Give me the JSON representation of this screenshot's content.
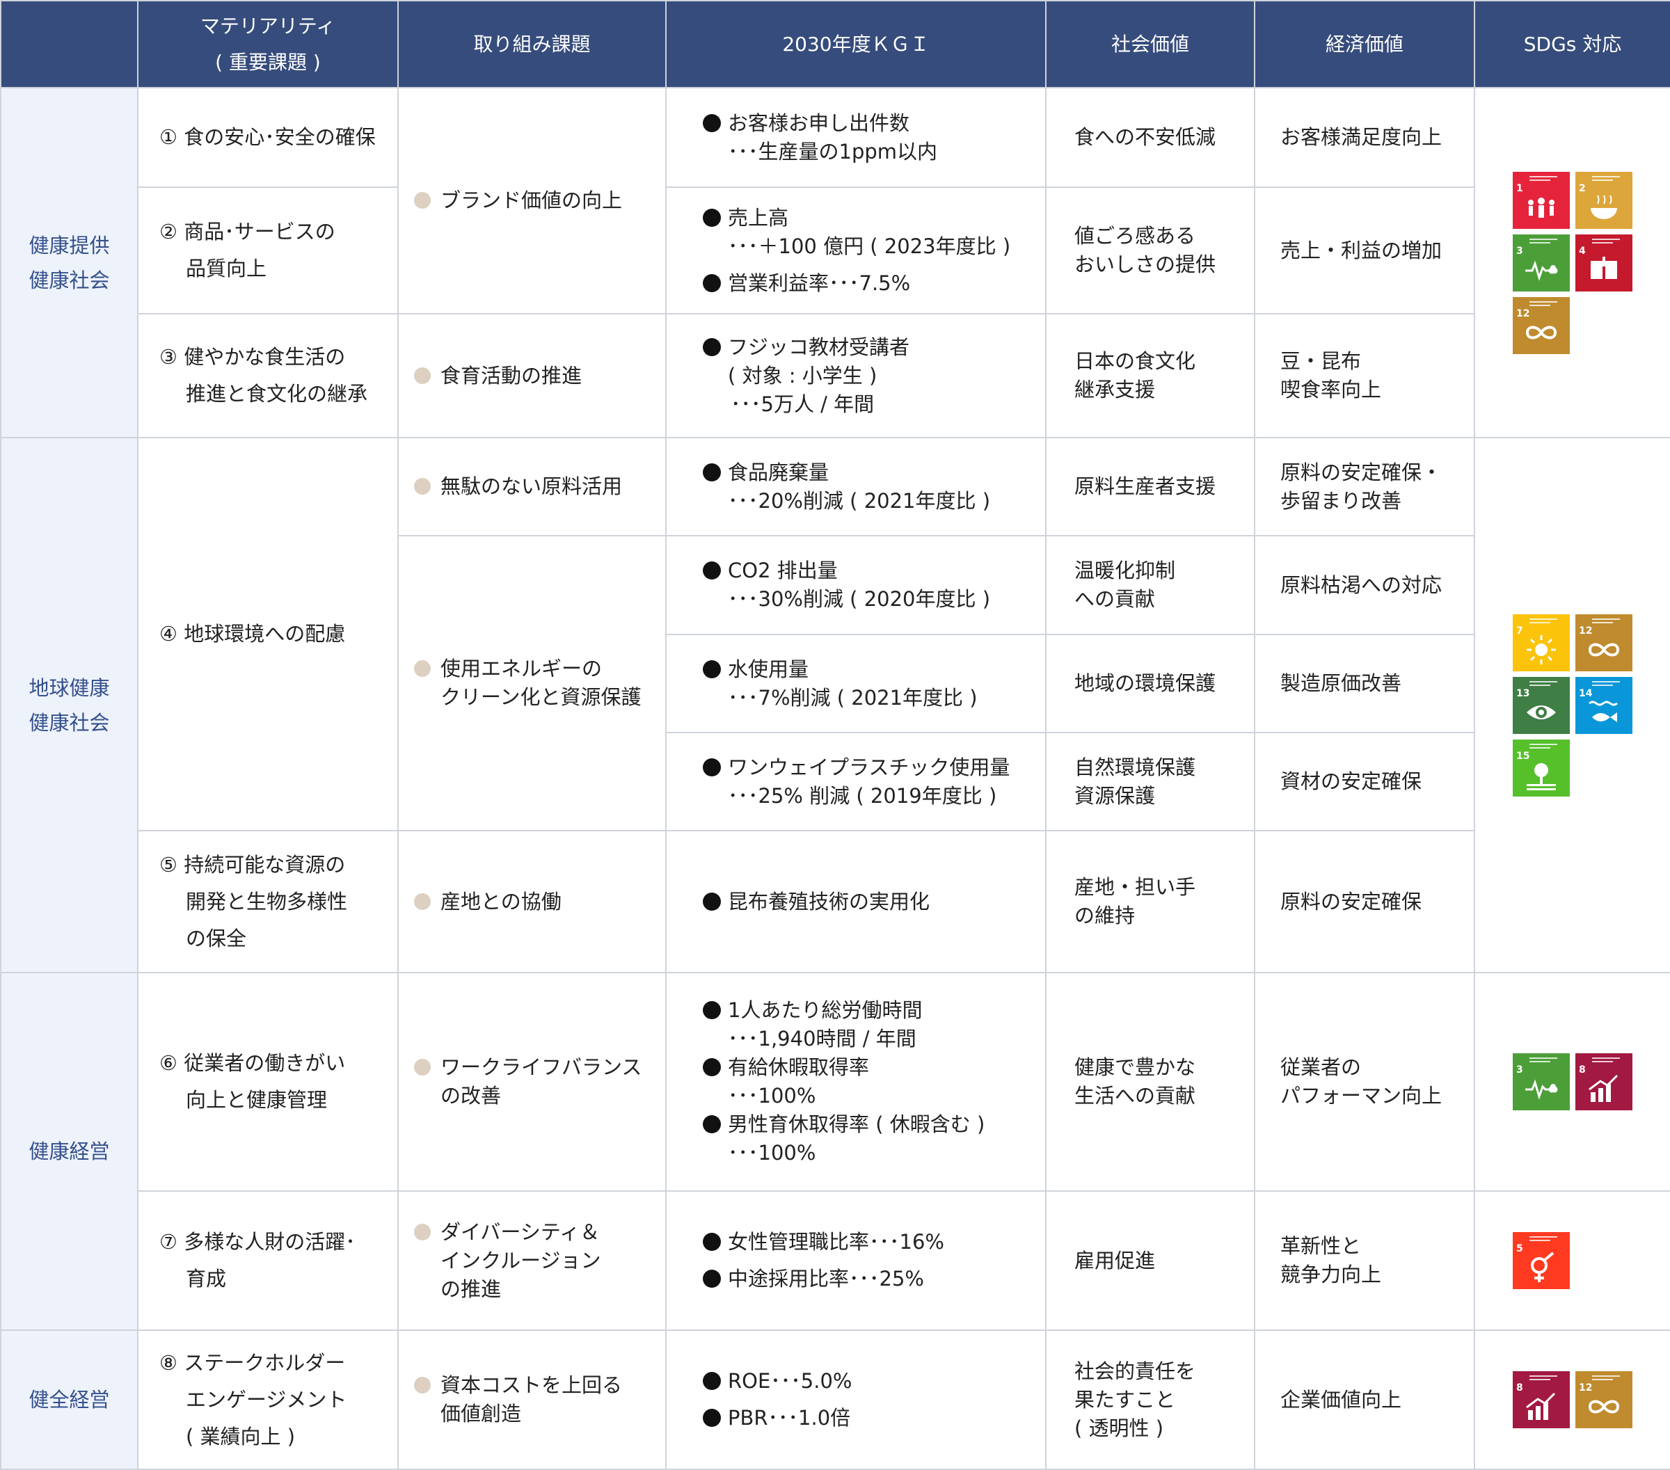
{
  "header": {
    "col1": "",
    "col2_line1": "マテリアリティ",
    "col2_line2": "( 重要課題 )",
    "col3": "取り組み課題",
    "col4": "2030年度ＫＧＩ",
    "col5": "社会価値",
    "col6": "経済価値",
    "col7": "SDGs 対応"
  },
  "categories": {
    "c1_line1": "健康提供",
    "c1_line2": "健康社会",
    "c2_line1": "地球健康",
    "c2_line2": "健康社会",
    "c3": "健康経営",
    "c4": "健全経営"
  },
  "materiality": {
    "m1_num": "①",
    "m1": "食の安心･安全の確保",
    "m2_num": "②",
    "m2_l1": "商品･サービスの",
    "m2_l2": "品質向上",
    "m3_num": "③",
    "m3_l1": "健やかな食生活の",
    "m3_l2": "推進と食文化の継承",
    "m4_num": "④",
    "m4": "地球環境への配慮",
    "m5_num": "⑤",
    "m5_l1": "持続可能な資源の",
    "m5_l2": "開発と生物多様性",
    "m5_l3": "の保全",
    "m6_num": "⑥",
    "m6_l1": "従業者の働きがい",
    "m6_l2": "向上と健康管理",
    "m7_num": "⑦",
    "m7_l1": "多様な人財の活躍･",
    "m7_l2": "育成",
    "m8_num": "⑧",
    "m8_l1": "ステークホルダー",
    "m8_l2": "エンゲージメント",
    "m8_l3": "( 業績向上 )"
  },
  "themes": {
    "t1": "ブランド価値の向上",
    "t2": "食育活動の推進",
    "t3": "無駄のない原料活用",
    "t4_l1": "使用エネルギーの",
    "t4_l2": "クリーン化と資源保護",
    "t5": "産地との協働",
    "t6_l1": "ワークライフバランス",
    "t6_l2": "の改善",
    "t7_l1": "ダイバーシティ＆",
    "t7_l2": "インクルージョン",
    "t7_l3": "の推進",
    "t8_l1": "資本コストを上回る",
    "t8_l2": "価値創造"
  },
  "kgi": {
    "k1_a": "お客様お申し出件数",
    "k1_b": "･･･生産量の1ppm以内",
    "k2_a": "売上高",
    "k2_b": "･･･＋100 億円 ( 2023年度比 )",
    "k2_c": "営業利益率･･･7.5%",
    "k3_a": "フジッコ教材受講者",
    "k3_b": "( 対象 : 小学生 )",
    "k3_c": "･･･5万人 / 年間",
    "k4_a": "食品廃棄量",
    "k4_b": "･･･20%削減 ( 2021年度比 )",
    "k5_a": "CO2 排出量",
    "k5_b": "･･･30%削減 ( 2020年度比 )",
    "k6_a": "水使用量",
    "k6_b": "･･･7%削減 ( 2021年度比 )",
    "k7_a": "ワンウェイプラスチック使用量",
    "k7_b": "･･･25% 削減 ( 2019年度比 )",
    "k8_a": "昆布養殖技術の実用化",
    "k9_a": "1人あたり総労働時間",
    "k9_b": "･･･1,940時間 / 年間",
    "k9_c": "有給休暇取得率",
    "k9_d": "･･･100%",
    "k9_e": "男性育休取得率 ( 休暇含む )",
    "k9_f": "･･･100%",
    "k10_a": "女性管理職比率･･･16%",
    "k10_b": "中途採用比率･･･25%",
    "k11_a": "ROE･･･5.0%",
    "k11_b": "PBR･･･1.0倍"
  },
  "social": {
    "s1": "食への不安低減",
    "s2_l1": "値ごろ感ある",
    "s2_l2": "おいしさの提供",
    "s3_l1": "日本の食文化",
    "s3_l2": "継承支援",
    "s4": "原料生産者支援",
    "s5_l1": "温暖化抑制",
    "s5_l2": "への貢献",
    "s6": "地域の環境保護",
    "s7_l1": "自然環境保護",
    "s7_l2": "資源保護",
    "s8_l1": "産地・担い手",
    "s8_l2": "の維持",
    "s9_l1": "健康で豊かな",
    "s9_l2": "生活への貢献",
    "s10": "雇用促進",
    "s11_l1": "社会的責任を",
    "s11_l2": "果たすこと",
    "s11_l3": "( 透明性 )"
  },
  "economic": {
    "e1": "お客様満足度向上",
    "e2": "売上・利益の増加",
    "e3_l1": "豆・昆布",
    "e3_l2": "喫食率向上",
    "e4_l1": "原料の安定確保・",
    "e4_l2": "歩留まり改善",
    "e5": "原料枯渇への対応",
    "e6": "製造原価改善",
    "e7": "資材の安定確保",
    "e8": "原料の安定確保",
    "e9_l1": "従業者の",
    "e9_l2": "パフォーマン向上",
    "e10_l1": "革新性と",
    "e10_l2": "競争力向上",
    "e11": "企業価値向上"
  },
  "sdg_icons": {
    "g1": [
      {
        "num": "1",
        "color": "#e5243b",
        "icon": "no-poverty-icon"
      },
      {
        "num": "2",
        "color": "#dda63a",
        "icon": "zero-hunger-icon"
      },
      {
        "num": "3",
        "color": "#4c9f38",
        "icon": "good-health-icon"
      },
      {
        "num": "4",
        "color": "#c5192d",
        "icon": "quality-education-icon"
      },
      {
        "num": "12",
        "color": "#bf8b2e",
        "icon": "responsible-consumption-icon"
      }
    ],
    "g2": [
      {
        "num": "7",
        "color": "#fcc30b",
        "icon": "clean-energy-icon"
      },
      {
        "num": "12",
        "color": "#bf8b2e",
        "icon": "responsible-consumption-icon"
      },
      {
        "num": "13",
        "color": "#3f7e44",
        "icon": "climate-action-icon"
      },
      {
        "num": "14",
        "color": "#0a97d9",
        "icon": "life-below-water-icon"
      },
      {
        "num": "15",
        "color": "#56c02b",
        "icon": "life-on-land-icon"
      }
    ],
    "g3": [
      {
        "num": "3",
        "color": "#4c9f38",
        "icon": "good-health-icon"
      },
      {
        "num": "8",
        "color": "#a21942",
        "icon": "decent-work-icon"
      }
    ],
    "g4": [
      {
        "num": "5",
        "color": "#ff3a21",
        "icon": "gender-equality-icon"
      }
    ],
    "g5": [
      {
        "num": "8",
        "color": "#a21942",
        "icon": "decent-work-icon"
      },
      {
        "num": "12",
        "color": "#bf8b2e",
        "icon": "responsible-consumption-icon"
      }
    ]
  }
}
